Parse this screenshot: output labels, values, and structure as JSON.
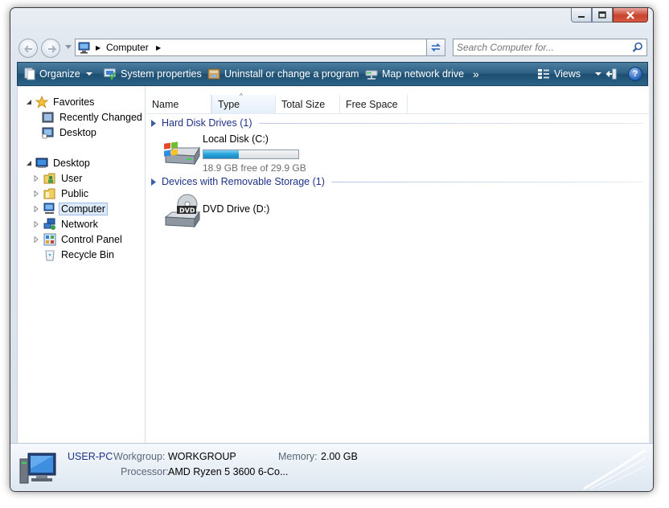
{
  "window": {
    "caption_buttons": [
      "minimize",
      "maximize",
      "close"
    ]
  },
  "address": {
    "crumb": "Computer",
    "search_placeholder": "Search Computer for..."
  },
  "commands": {
    "organize": "Organize",
    "system_properties": "System properties",
    "uninstall": "Uninstall or change a program",
    "map_drive": "Map network drive",
    "overflow": "»",
    "views": "Views",
    "help": "?"
  },
  "nav": {
    "favorites_header": "Favorites",
    "favorites": [
      "Recently Changed",
      "Desktop"
    ],
    "desktop_header": "Desktop",
    "desktop_items": [
      "User",
      "Public",
      "Computer",
      "Network",
      "Control Panel",
      "Recycle Bin"
    ],
    "selected": "Computer"
  },
  "columns": [
    "Name",
    "Type",
    "Total Size",
    "Free Space"
  ],
  "sorted_column": "Type",
  "groups": {
    "hard_disks": {
      "label": "Hard Disk Drives (1)",
      "drives": [
        {
          "name": "Local Disk (C:)",
          "free_text": "18.9 GB free of 29.9 GB",
          "used_fraction": 0.37,
          "icon": "hard-disk-icon"
        }
      ]
    },
    "removable": {
      "label": "Devices with Removable Storage (1)",
      "drives": [
        {
          "name": "DVD Drive (D:)",
          "icon": "dvd-drive-icon"
        }
      ]
    }
  },
  "details": {
    "computer_name": "USER-PC",
    "workgroup_label": "Workgroup:",
    "workgroup": "WORKGROUP",
    "memory_label": "Memory:",
    "memory": "2.00 GB",
    "processor_label": "Processor:",
    "processor": "AMD Ryzen 5 3600 6-Co..."
  },
  "colors": {
    "command_bar": "#2c5f82",
    "group_text": "#1e3287",
    "usage_bar": "#26a0da",
    "close_button": "#c7432e"
  }
}
